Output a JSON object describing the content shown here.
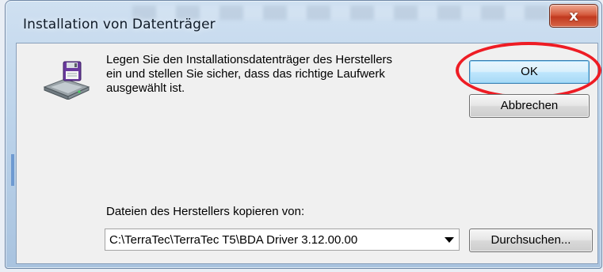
{
  "window": {
    "title": "Installation von Datenträger",
    "close_label": "x"
  },
  "dialog": {
    "icon": "floppy-disk-drive-icon",
    "message": "Legen Sie den Installationsdatenträger des Herstellers\nein und stellen Sie sicher, dass das richtige Laufwerk\nausgewählt ist.",
    "ok_label": "OK",
    "cancel_label": "Abbrechen",
    "copy_from_label": "Dateien des Herstellers kopieren von:",
    "path_value": "C:\\TerraTec\\TerraTec T5\\BDA Driver 3.12.00.00",
    "browse_label": "Durchsuchen...",
    "highlight_color": "#ee1c24"
  }
}
